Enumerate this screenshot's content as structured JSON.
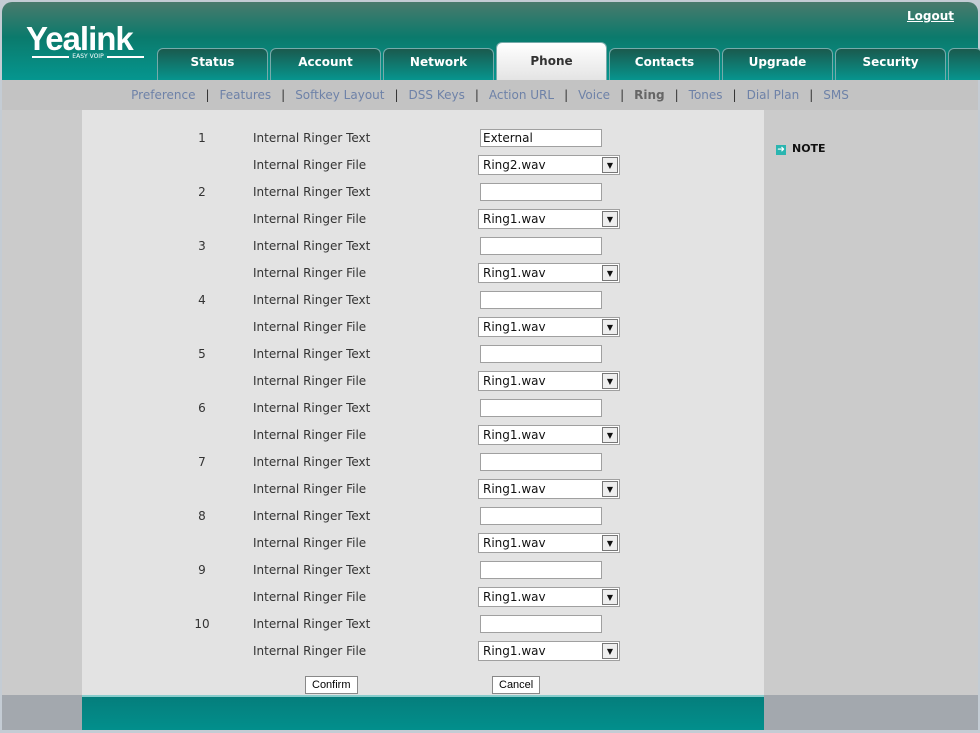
{
  "header": {
    "logo": "Yealink",
    "logo_tagline": "EASY VOIP",
    "logout": "Logout"
  },
  "tabs": [
    {
      "label": "Status"
    },
    {
      "label": "Account"
    },
    {
      "label": "Network"
    },
    {
      "label": "Phone",
      "active": true
    },
    {
      "label": "Contacts"
    },
    {
      "label": "Upgrade"
    },
    {
      "label": "Security"
    }
  ],
  "subnav": [
    {
      "label": "Preference"
    },
    {
      "label": "Features"
    },
    {
      "label": "Softkey Layout"
    },
    {
      "label": "DSS Keys"
    },
    {
      "label": "Action URL"
    },
    {
      "label": "Voice"
    },
    {
      "label": "Ring",
      "active": true
    },
    {
      "label": "Tones"
    },
    {
      "label": "Dial Plan"
    },
    {
      "label": "SMS"
    }
  ],
  "note": {
    "label": "NOTE",
    "icon": "arrow-right-icon"
  },
  "labels": {
    "text": "Internal Ringer Text",
    "file": "Internal Ringer File"
  },
  "ringers": [
    {
      "index": "1",
      "text": "External",
      "file": "Ring2.wav"
    },
    {
      "index": "2",
      "text": "",
      "file": "Ring1.wav"
    },
    {
      "index": "3",
      "text": "",
      "file": "Ring1.wav"
    },
    {
      "index": "4",
      "text": "",
      "file": "Ring1.wav"
    },
    {
      "index": "5",
      "text": "",
      "file": "Ring1.wav"
    },
    {
      "index": "6",
      "text": "",
      "file": "Ring1.wav"
    },
    {
      "index": "7",
      "text": "",
      "file": "Ring1.wav"
    },
    {
      "index": "8",
      "text": "",
      "file": "Ring1.wav"
    },
    {
      "index": "9",
      "text": "",
      "file": "Ring1.wav"
    },
    {
      "index": "10",
      "text": "",
      "file": "Ring1.wav"
    }
  ],
  "buttons": {
    "confirm": "Confirm",
    "cancel": "Cancel"
  },
  "colors": {
    "brand_teal": "#05968f",
    "subnav_link": "#6e82a8"
  }
}
